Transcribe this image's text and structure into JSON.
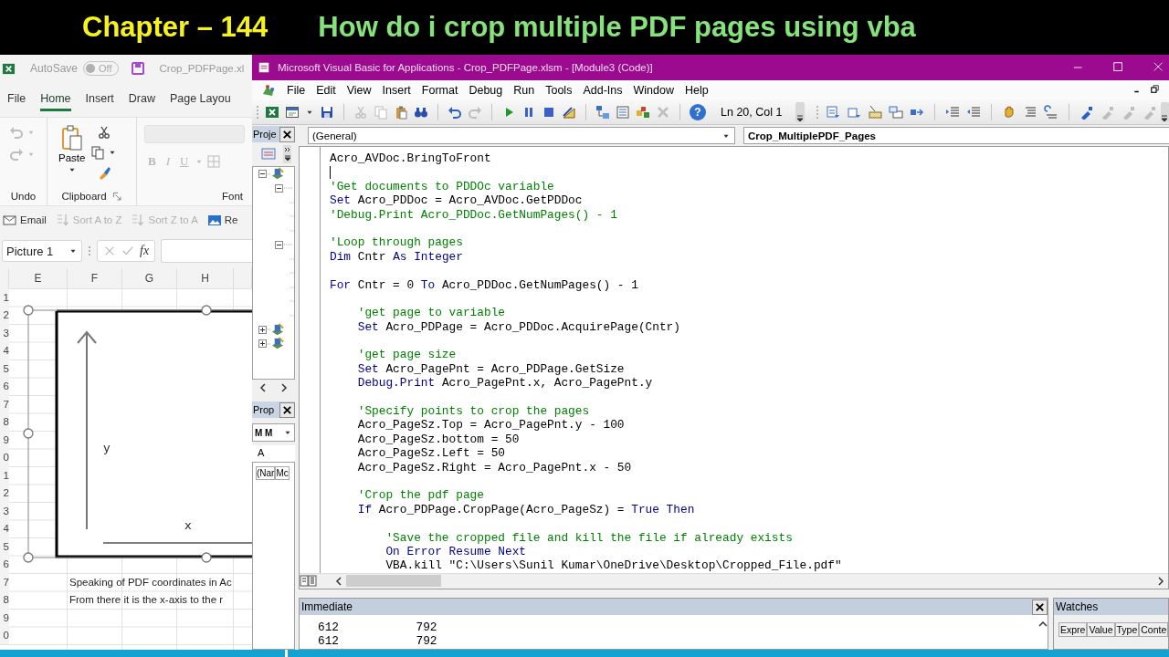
{
  "banner": {
    "chapter": "Chapter – 144",
    "title": "How do i crop multiple PDF pages using vba"
  },
  "excel": {
    "title_bar": {
      "autosave_label": "AutoSave",
      "autosave": {
        "label": "Off",
        "on": false
      },
      "filename": "Crop_PDFPage.xl"
    },
    "ribbon_tabs": [
      {
        "label": "File",
        "selected": false
      },
      {
        "label": "Home",
        "selected": true
      },
      {
        "label": "Insert",
        "selected": false
      },
      {
        "label": "Draw",
        "selected": false
      },
      {
        "label": "Page Layou",
        "selected": false
      }
    ],
    "ribbon_groups": [
      "Undo",
      "Clipboard",
      "Font"
    ],
    "paste_label": "Paste",
    "font_buttons": [
      {
        "label": "B",
        "disabled": true
      },
      {
        "label": "I",
        "disabled": true
      },
      {
        "label": "U",
        "disabled": true
      }
    ],
    "quick_actions": [
      {
        "label": "Email",
        "kind": "email",
        "disabled": false
      },
      {
        "label": "Sort A to Z",
        "kind": "sort",
        "disabled": true
      },
      {
        "label": "Sort Z to A",
        "kind": "sort",
        "disabled": true
      },
      {
        "label": "Re",
        "kind": "image",
        "disabled": false
      }
    ],
    "name_box": "Picture 1",
    "formula_label": "fx",
    "columns": [
      "E",
      "F",
      "G",
      "H"
    ],
    "rows": [
      {
        "number": "1"
      },
      {
        "number": "2"
      },
      {
        "number": "3"
      },
      {
        "number": "4"
      },
      {
        "number": "5"
      },
      {
        "number": "6"
      },
      {
        "number": "7"
      },
      {
        "number": "8"
      },
      {
        "number": "9"
      },
      {
        "number": "0"
      },
      {
        "number": "1"
      },
      {
        "number": "2"
      },
      {
        "number": "3"
      },
      {
        "number": "4"
      },
      {
        "number": "5"
      },
      {
        "number": "6"
      },
      {
        "number": "7",
        "text": "Speaking of PDF coordinates in Ac"
      },
      {
        "number": "8",
        "text": "From there it is the x-axis to the r"
      },
      {
        "number": "9"
      },
      {
        "number": "0"
      }
    ],
    "diagram": {
      "selected": true,
      "y_label": "y",
      "x_label": "x"
    }
  },
  "vba": {
    "title": "Microsoft Visual Basic for Applications - Crop_PDFPage.xlsm - [Module3 (Code)]",
    "menu": [
      "File",
      "Edit",
      "View",
      "Insert",
      "Format",
      "Debug",
      "Run",
      "Tools",
      "Add-Ins",
      "Window",
      "Help"
    ],
    "toolbar": [
      [
        {
          "kind": "excel",
          "disabled": false
        },
        {
          "kind": "userform",
          "disabled": false
        },
        {
          "kind": "caret",
          "disabled": false
        },
        {
          "kind": "save",
          "disabled": false
        }
      ],
      [
        {
          "kind": "cut",
          "disabled": true
        },
        {
          "kind": "copy",
          "disabled": true
        },
        {
          "kind": "paste",
          "disabled": false
        },
        {
          "kind": "find",
          "disabled": false
        }
      ],
      [
        {
          "kind": "undo",
          "disabled": false
        },
        {
          "kind": "redo",
          "disabled": true
        }
      ],
      [
        {
          "kind": "run",
          "disabled": false
        },
        {
          "kind": "pause",
          "disabled": false
        },
        {
          "kind": "stop",
          "disabled": false
        },
        {
          "kind": "design",
          "disabled": false
        }
      ],
      [
        {
          "kind": "project",
          "disabled": false
        },
        {
          "kind": "properties",
          "disabled": false
        },
        {
          "kind": "objects",
          "disabled": false
        },
        {
          "kind": "toolbox",
          "disabled": true
        }
      ],
      [
        {
          "kind": "help",
          "glyph": "?",
          "disabled": false
        }
      ]
    ],
    "position": "Ln 20, Col 1",
    "toolbar_2": [
      [
        {
          "kind": "list_members",
          "disabled": false
        },
        {
          "kind": "list_constants",
          "disabled": false
        },
        {
          "kind": "quick_info",
          "disabled": false
        },
        {
          "kind": "parameter_info",
          "disabled": false
        },
        {
          "kind": "complete_word",
          "disabled": false
        }
      ],
      [
        {
          "kind": "indent",
          "disabled": false
        },
        {
          "kind": "outdent",
          "disabled": false
        }
      ],
      [
        {
          "kind": "breakpoint",
          "disabled": false
        },
        {
          "kind": "comment",
          "disabled": false
        },
        {
          "kind": "uncomment",
          "disabled": false
        }
      ],
      [
        {
          "kind": "bookmark",
          "disabled": false
        },
        {
          "kind": "bookmark",
          "disabled": true
        },
        {
          "kind": "bookmark",
          "disabled": true
        },
        {
          "kind": "bookmark",
          "disabled": true
        }
      ]
    ],
    "project_panel": {
      "title": "Proje",
      "tree": [
        {
          "kind": "project",
          "expanded": true,
          "children": [
            {
              "kind": "folder",
              "expanded": true,
              "children": [
                {
                  "kind": "leaf"
                },
                {
                  "kind": "leaf"
                },
                {
                  "kind": "leaf"
                }
              ]
            },
            {
              "kind": "folder",
              "expanded": true,
              "children": [
                {
                  "kind": "leaf"
                },
                {
                  "kind": "leaf"
                },
                {
                  "kind": "leaf"
                },
                {
                  "kind": "leaf"
                },
                {
                  "kind": "leaf"
                }
              ]
            }
          ]
        },
        {
          "kind": "project",
          "expanded": false
        },
        {
          "kind": "project",
          "expanded": false
        }
      ]
    },
    "properties_panel": {
      "title": "Prop",
      "object_box": "M M",
      "tabs": [
        {
          "label": "A",
          "selected": true
        }
      ],
      "columns": [
        "(Nar",
        "Mc"
      ]
    },
    "object_box": "(General)",
    "procedure_box": "Crop_MultiplePDF_Pages",
    "code": [
      {
        "kind": "code",
        "cursor": false,
        "segments": [
          {
            "text": "Acro_AVDoc.BringToFront",
            "kind": "plain"
          }
        ]
      },
      {
        "kind": "blank",
        "cursor": true
      },
      {
        "kind": "code",
        "cursor": false,
        "segments": [
          {
            "text": "'Get documents to PDDOc variable",
            "kind": "comment"
          }
        ]
      },
      {
        "kind": "code",
        "cursor": false,
        "segments": [
          {
            "text": "Set",
            "kind": "keyword"
          },
          {
            "text": " Acro_PDDoc = Acro_AVDoc.GetPDDoc",
            "kind": "plain"
          }
        ]
      },
      {
        "kind": "code",
        "cursor": false,
        "segments": [
          {
            "text": "'Debug.Print Acro_PDDoc.GetNumPages() - 1",
            "kind": "comment"
          }
        ]
      },
      {
        "kind": "blank",
        "cursor": false
      },
      {
        "kind": "code",
        "cursor": false,
        "segments": [
          {
            "text": "'Loop through pages",
            "kind": "comment"
          }
        ]
      },
      {
        "kind": "code",
        "cursor": false,
        "segments": [
          {
            "text": "Dim",
            "kind": "keyword"
          },
          {
            "text": " Cntr ",
            "kind": "plain"
          },
          {
            "text": "As Integer",
            "kind": "keyword"
          }
        ]
      },
      {
        "kind": "blank",
        "cursor": false
      },
      {
        "kind": "code",
        "cursor": false,
        "segments": [
          {
            "text": "For",
            "kind": "keyword"
          },
          {
            "text": " Cntr = 0 ",
            "kind": "plain"
          },
          {
            "text": "To",
            "kind": "keyword"
          },
          {
            "text": " Acro_PDDoc.GetNumPages() - 1",
            "kind": "plain"
          }
        ]
      },
      {
        "kind": "blank",
        "cursor": false
      },
      {
        "kind": "code",
        "cursor": false,
        "segments": [
          {
            "text": "    'get page to variable",
            "kind": "comment"
          }
        ]
      },
      {
        "kind": "code",
        "cursor": false,
        "segments": [
          {
            "text": "    Set",
            "kind": "keyword"
          },
          {
            "text": " Acro_PDPage = Acro_PDDoc.AcquirePage(Cntr)",
            "kind": "plain"
          }
        ]
      },
      {
        "kind": "blank",
        "cursor": false
      },
      {
        "kind": "code",
        "cursor": false,
        "segments": [
          {
            "text": "    'get page size",
            "kind": "comment"
          }
        ]
      },
      {
        "kind": "code",
        "cursor": false,
        "segments": [
          {
            "text": "    Set",
            "kind": "keyword"
          },
          {
            "text": " Acro_PagePnt = Acro_PDPage.GetSize",
            "kind": "plain"
          }
        ]
      },
      {
        "kind": "code",
        "cursor": false,
        "segments": [
          {
            "text": "    Debug.Print",
            "kind": "keyword"
          },
          {
            "text": " Acro_PagePnt.x, Acro_PagePnt.y",
            "kind": "plain"
          }
        ]
      },
      {
        "kind": "blank",
        "cursor": false
      },
      {
        "kind": "code",
        "cursor": false,
        "segments": [
          {
            "text": "    'Specify points to crop the pages",
            "kind": "comment"
          }
        ]
      },
      {
        "kind": "code",
        "cursor": false,
        "segments": [
          {
            "text": "    Acro_PageSz.Top = Acro_PagePnt.y - 100",
            "kind": "plain"
          }
        ]
      },
      {
        "kind": "code",
        "cursor": false,
        "segments": [
          {
            "text": "    Acro_PageSz.bottom = 50",
            "kind": "plain"
          }
        ]
      },
      {
        "kind": "code",
        "cursor": false,
        "segments": [
          {
            "text": "    Acro_PageSz.Left = 50",
            "kind": "plain"
          }
        ]
      },
      {
        "kind": "code",
        "cursor": false,
        "segments": [
          {
            "text": "    Acro_PageSz.Right = Acro_PagePnt.x - 50",
            "kind": "plain"
          }
        ]
      },
      {
        "kind": "blank",
        "cursor": false
      },
      {
        "kind": "code",
        "cursor": false,
        "segments": [
          {
            "text": "    'Crop the pdf page",
            "kind": "comment"
          }
        ]
      },
      {
        "kind": "code",
        "cursor": false,
        "segments": [
          {
            "text": "    If",
            "kind": "keyword"
          },
          {
            "text": " Acro_PDPage.CropPage(Acro_PageSz) = ",
            "kind": "plain"
          },
          {
            "text": "True Then",
            "kind": "keyword"
          }
        ]
      },
      {
        "kind": "blank",
        "cursor": false
      },
      {
        "kind": "code",
        "cursor": false,
        "segments": [
          {
            "text": "        'Save the cropped file and kill the file if already exists",
            "kind": "comment"
          }
        ]
      },
      {
        "kind": "code",
        "cursor": false,
        "segments": [
          {
            "text": "        On Error Resume Next",
            "kind": "keyword"
          }
        ]
      },
      {
        "kind": "code",
        "cursor": false,
        "segments": [
          {
            "text": "        VBA.kill \"C:\\Users\\Sunil Kumar\\OneDrive\\Desktop\\Cropped_File.pdf\"",
            "kind": "plain"
          }
        ]
      }
    ],
    "immediate": {
      "title": "Immediate",
      "lines": [
        "612           792",
        "612           792"
      ]
    },
    "watches": {
      "title": "Watches",
      "columns": [
        "Expre",
        "Value",
        "Type",
        "Conte"
      ]
    }
  }
}
